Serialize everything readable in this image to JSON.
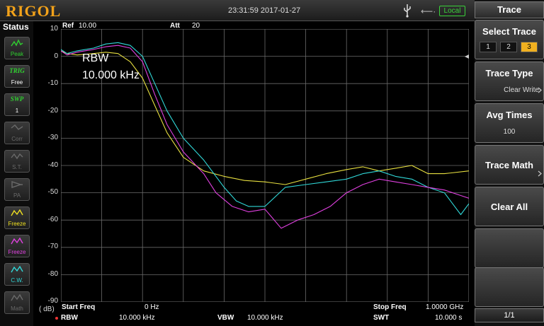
{
  "brand": {
    "logo": "RIGOL",
    "logo_color": "#f2a21a"
  },
  "topbar": {
    "datetime": "23:31:59 2017-01-27",
    "local_label": "Local",
    "icons": [
      "usb-icon",
      "network-icon"
    ]
  },
  "status": {
    "title": "Status",
    "items": [
      {
        "icon": "peak-icon",
        "label": "Peak",
        "color": "#2fd12f"
      },
      {
        "top": "TRIG",
        "label": "Free",
        "color": "#2fd12f"
      },
      {
        "top": "SWP",
        "label": "1",
        "color": "#2fd12f"
      },
      {
        "icon": "corr-icon",
        "label": "Corr",
        "color": "#6a6a6a"
      },
      {
        "icon": "st-icon",
        "label": "S.T.",
        "color": "#6a6a6a"
      },
      {
        "icon": "pa-icon",
        "label": "PA",
        "color": "#6a6a6a"
      },
      {
        "icon": "trace-freeze-icon",
        "label": "Freeze",
        "color": "#f0e020"
      },
      {
        "icon": "trace-freeze-icon",
        "label": "Freeze",
        "color": "#e040e0"
      },
      {
        "icon": "trace-clearwrite-icon",
        "label": "C.W.",
        "color": "#30d8d8"
      },
      {
        "icon": "trace-math-icon",
        "label": "Math",
        "color": "#6a6a6a"
      }
    ]
  },
  "graph": {
    "ref_label": "Ref",
    "ref_value": "10.00 dBm",
    "att_label": "Att",
    "att_value": "20 dB",
    "unit": "( dB)",
    "rbw_overlay_label": "RBW",
    "rbw_overlay_value": "10.000 kHz",
    "y_ticks": [
      "10",
      "0",
      "-10",
      "-20",
      "-30",
      "-40",
      "-50",
      "-60",
      "-70",
      "-80",
      "-90"
    ]
  },
  "bottom": {
    "start_freq_label": "Start Freq",
    "start_freq_value": "0 Hz",
    "stop_freq_label": "Stop Freq",
    "stop_freq_value": "1.0000 GHz",
    "rbw_label": "RBW",
    "rbw_value": "10.000 kHz",
    "vbw_label": "VBW",
    "vbw_value": "10.000 kHz",
    "swt_label": "SWT",
    "swt_value": "10.000 s"
  },
  "menu": {
    "title": "Trace",
    "select_trace_label": "Select Trace",
    "trace_options": [
      "1",
      "2",
      "3"
    ],
    "selected_trace": "3",
    "trace_type_label": "Trace Type",
    "trace_type_value": "Clear Write",
    "avg_times_label": "Avg Times",
    "avg_times_value": "100",
    "trace_math_label": "Trace Math",
    "clear_all_label": "Clear All",
    "page": "1/1"
  },
  "chart_data": {
    "type": "line",
    "xlim": [
      0,
      1000
    ],
    "ylim": [
      -90,
      10
    ],
    "grid": true,
    "series": [
      {
        "color": "#e8e040",
        "x": [
          0,
          15,
          40,
          80,
          110,
          140,
          170,
          200,
          230,
          260,
          300,
          350,
          400,
          450,
          500,
          550,
          600,
          650,
          700,
          740,
          780,
          820,
          860,
          900,
          940,
          1000
        ],
        "y": [
          2,
          1,
          0.5,
          1,
          1.5,
          1,
          -2,
          -8,
          -18,
          -28,
          -37,
          -42,
          -44,
          -45.5,
          -46,
          -47,
          -45,
          -43,
          -41.5,
          -40.5,
          -42,
          -41,
          -40,
          -43,
          -43,
          -42
        ]
      },
      {
        "color": "#30d8d8",
        "x": [
          0,
          15,
          40,
          80,
          110,
          140,
          170,
          200,
          230,
          260,
          300,
          350,
          400,
          430,
          460,
          500,
          550,
          600,
          650,
          700,
          740,
          780,
          820,
          860,
          900,
          940,
          980,
          1000
        ],
        "y": [
          2.5,
          1,
          2,
          3,
          4.5,
          5,
          4,
          0,
          -10,
          -20,
          -30,
          -38,
          -48,
          -53,
          -55,
          -55,
          -48,
          -47,
          -46,
          -45,
          -43,
          -42,
          -44,
          -45,
          -48,
          -50,
          -58,
          -54
        ]
      },
      {
        "color": "#e040e0",
        "x": [
          0,
          15,
          40,
          80,
          110,
          140,
          170,
          200,
          230,
          260,
          300,
          350,
          380,
          420,
          460,
          500,
          540,
          580,
          620,
          660,
          700,
          740,
          780,
          820,
          860,
          900,
          940,
          980,
          1000
        ],
        "y": [
          2,
          0.5,
          1.5,
          2.5,
          3.5,
          4,
          3,
          -2,
          -14,
          -25,
          -35,
          -43,
          -50,
          -55,
          -57,
          -56,
          -63,
          -60,
          -58,
          -55,
          -50,
          -47,
          -45,
          -46,
          -47,
          -48,
          -49,
          -51,
          -52
        ]
      }
    ]
  }
}
